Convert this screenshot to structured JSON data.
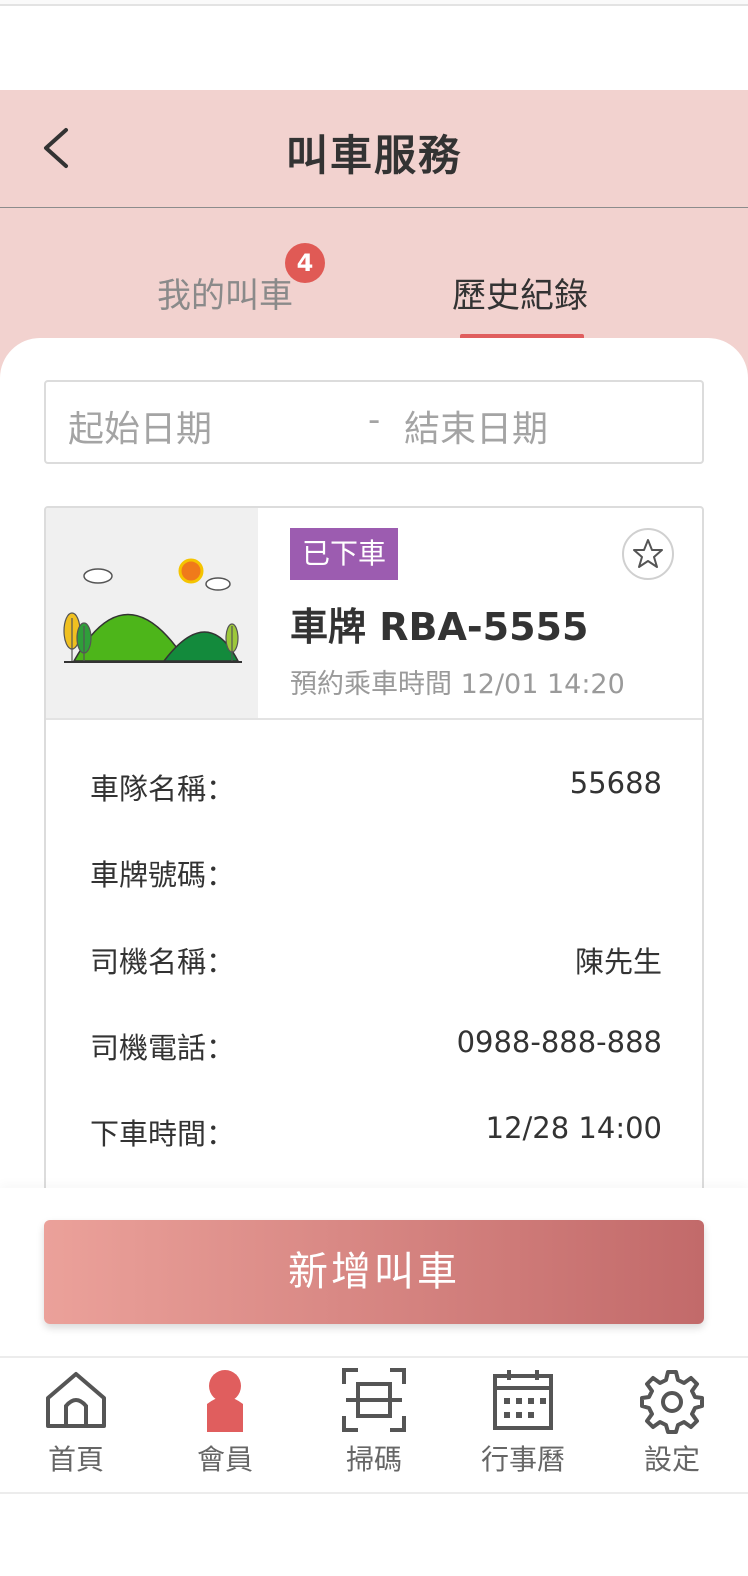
{
  "header": {
    "title": "叫車服務"
  },
  "tabs": [
    {
      "label": "我的叫車",
      "badge": "4",
      "active": false
    },
    {
      "label": "歷史紀錄",
      "active": true
    }
  ],
  "date_filter": {
    "start_placeholder": "起始日期",
    "separator": "-",
    "end_placeholder": "結束日期"
  },
  "ride": {
    "status": "已下車",
    "status_color": "#9c5cb0",
    "plate_title": "車牌 RBA-5555",
    "schedule": "預約乘車時間 12/01 14:20",
    "details": [
      {
        "label": "車隊名稱：",
        "value": "55688"
      },
      {
        "label": "車牌號碼：",
        "value": ""
      },
      {
        "label": "司機名稱：",
        "value": "陳先生"
      },
      {
        "label": "司機電話：",
        "value": "0988-888-888"
      },
      {
        "label": "下車時間：",
        "value": "12/28 14:00"
      }
    ]
  },
  "add_button": {
    "label": "新增叫車"
  },
  "nav": [
    {
      "label": "首頁",
      "icon": "home-icon"
    },
    {
      "label": "會員",
      "icon": "member-icon",
      "active": true
    },
    {
      "label": "掃碼",
      "icon": "scan-icon"
    },
    {
      "label": "行事曆",
      "icon": "calendar-icon"
    },
    {
      "label": "設定",
      "icon": "gear-icon"
    }
  ],
  "colors": {
    "header_bg": "#f2d2cf",
    "accent": "#e05e5e",
    "active_nav": "#e05e5e"
  }
}
